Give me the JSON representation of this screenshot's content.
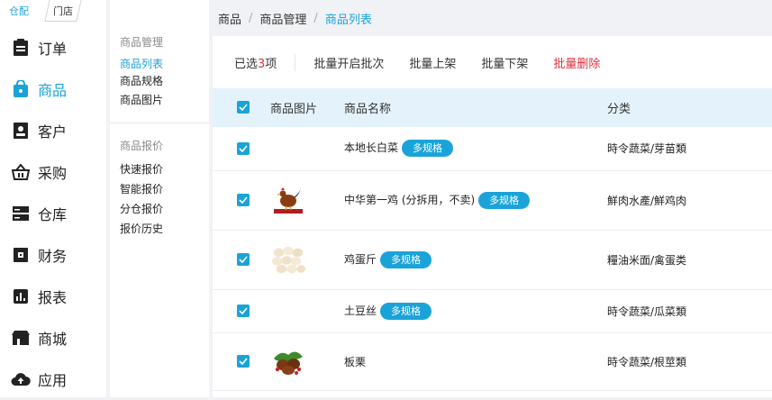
{
  "top_tabs": {
    "active": "仓配",
    "inactive": "门店"
  },
  "main_nav": [
    {
      "label": "订单",
      "icon": "clipboard-icon",
      "active": false
    },
    {
      "label": "商品",
      "icon": "shopping-bag-icon",
      "active": true
    },
    {
      "label": "客户",
      "icon": "contact-card-icon",
      "active": false
    },
    {
      "label": "采购",
      "icon": "basket-icon",
      "active": false
    },
    {
      "label": "仓库",
      "icon": "server-icon",
      "active": false
    },
    {
      "label": "财务",
      "icon": "wallet-icon",
      "active": false
    },
    {
      "label": "报表",
      "icon": "bar-chart-icon",
      "active": false
    },
    {
      "label": "商城",
      "icon": "store-icon",
      "active": false
    },
    {
      "label": "应用",
      "icon": "cloud-icon",
      "active": false
    }
  ],
  "sub_nav": {
    "group1_title": "商品管理",
    "group1_items": [
      "商品列表",
      "商品规格",
      "商品图片"
    ],
    "group2_title": "商品报价",
    "group2_items": [
      "快速报价",
      "智能报价",
      "分仓报价",
      "报价历史"
    ]
  },
  "breadcrumb": {
    "level1": "商品",
    "level2": "商品管理",
    "current": "商品列表",
    "sep": "/"
  },
  "toolbar": {
    "selected_prefix": "已选",
    "selected_count": "3",
    "selected_suffix": "项",
    "actions": [
      "批量开启批次",
      "批量上架",
      "批量下架"
    ],
    "delete_label": "批量删除"
  },
  "table": {
    "headers": {
      "image": "商品图片",
      "name": "商品名称",
      "category": "分类"
    },
    "rows": [
      {
        "name": "本地长白菜",
        "tag": "多规格",
        "category": "時令蔬菜/芽苗類",
        "image": ""
      },
      {
        "name": "中华第一鸡 (分拆用，不卖)",
        "tag": "多规格",
        "category": "鮮肉水產/鮮鸡肉",
        "image": "rooster-image"
      },
      {
        "name": "鸡蛋斤",
        "tag": "多规格",
        "category": "糧油米面/禽蛋类",
        "image": "eggs-image"
      },
      {
        "name": "土豆丝",
        "tag": "多规格",
        "category": "時令蔬菜/瓜菜類",
        "image": ""
      },
      {
        "name": "板栗",
        "tag": "",
        "category": "時令蔬菜/根莖類",
        "image": "chestnut-image"
      }
    ]
  },
  "colors": {
    "accent": "#1aa3d9",
    "danger": "#e0303c",
    "header_bg": "#e4f3fb"
  }
}
